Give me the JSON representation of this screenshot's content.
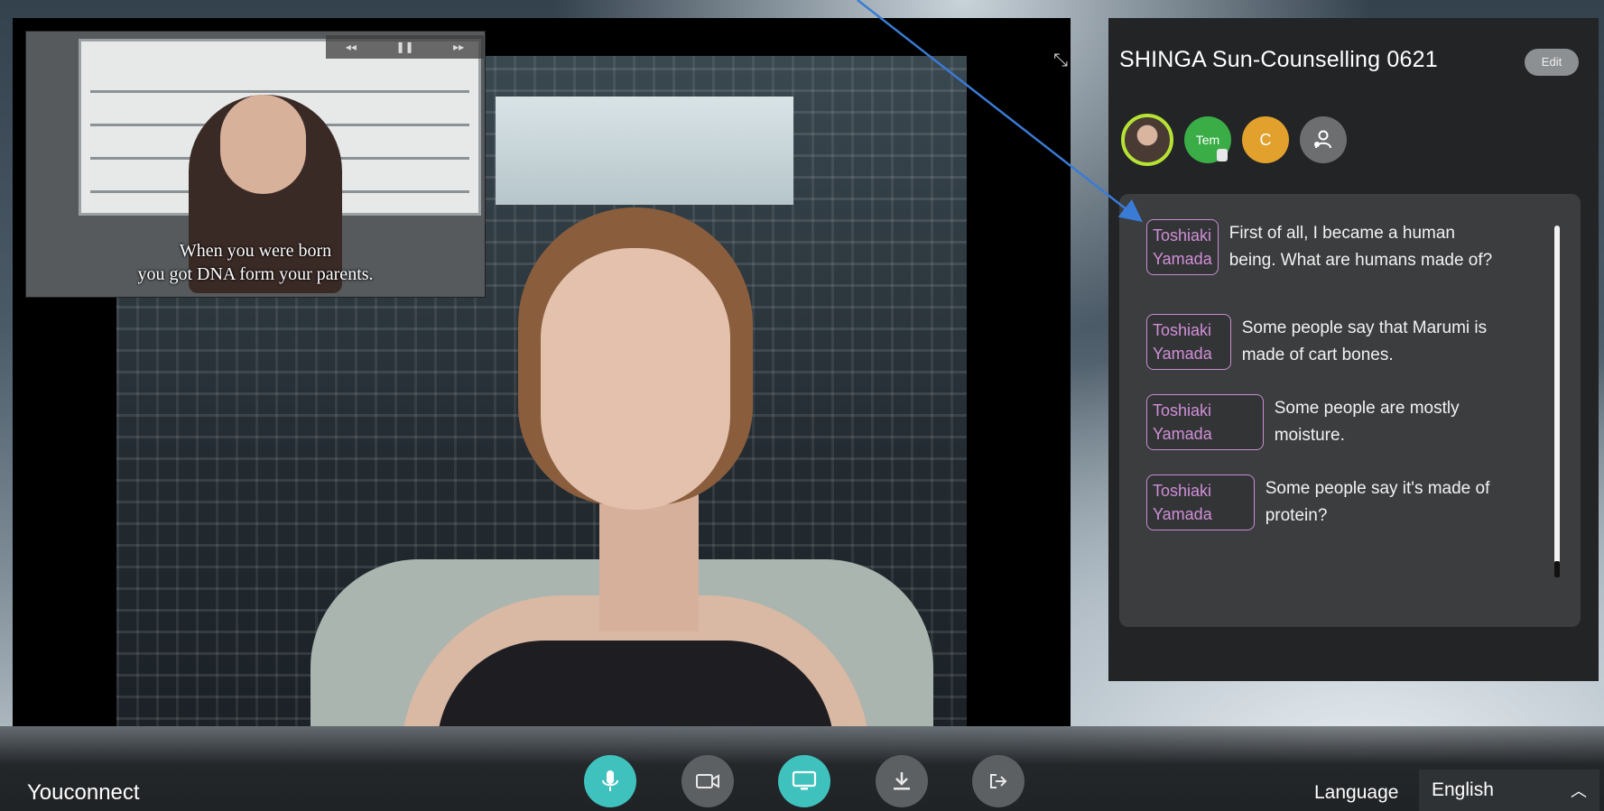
{
  "pip": {
    "caption_line1": "When you were born",
    "caption_line2": "you got DNA form your parents."
  },
  "sidebar": {
    "title": "SHINGA Sun-Counselling 0621",
    "edit_label": "Edit",
    "participants": [
      {
        "initials": "",
        "type": "photo"
      },
      {
        "initials": "Tem",
        "type": "green"
      },
      {
        "initials": "C",
        "type": "orange"
      },
      {
        "initials": "",
        "type": "add-person-icon"
      }
    ]
  },
  "chat": {
    "messages": [
      {
        "name": "Toshiaki\nYamada",
        "text": "First of all, I became a human being. What are humans made of?"
      },
      {
        "name": "Toshiaki\nYamada",
        "text": "Some people say that Marumi is made of cart bones."
      },
      {
        "name": "Toshiaki\nYamada",
        "text": "Some people are mostly moisture."
      },
      {
        "name": "Toshiaki\nYamada",
        "text": "Some people say it's made of protein?"
      }
    ]
  },
  "footer": {
    "brand": "Youconnect",
    "language_label": "Language",
    "language_value": "English"
  },
  "controls": {
    "mic": "microphone-icon",
    "camera": "camera-icon",
    "screen": "screen-share-icon",
    "download": "download-icon",
    "leave": "leave-icon"
  },
  "colors": {
    "teal": "#3fc2bd",
    "speaker_name": "#d08fd8",
    "avatar_green": "#3aad46",
    "avatar_orange": "#e2a02c",
    "active_ring": "#b6e234",
    "arrow": "#3a7bd5"
  }
}
